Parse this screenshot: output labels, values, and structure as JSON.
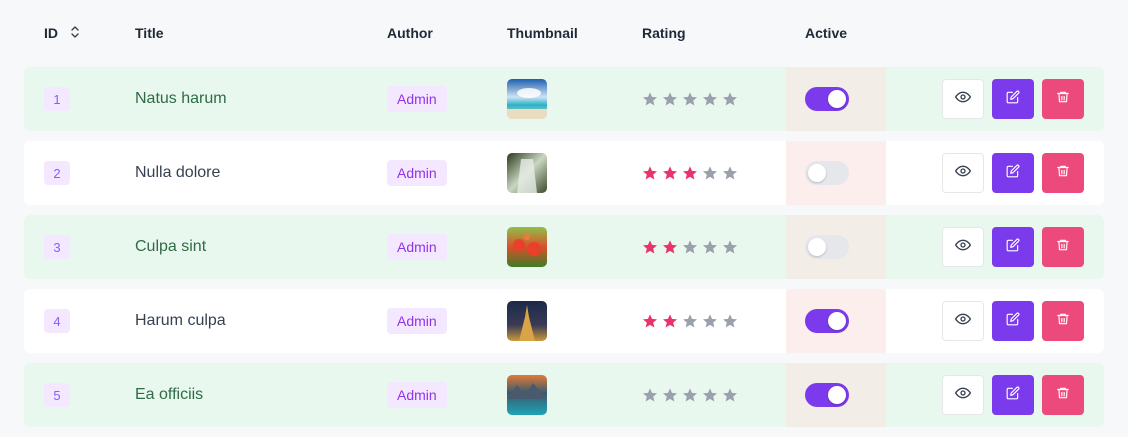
{
  "colors": {
    "accent": "#7c3aed",
    "danger": "#ec4a7c",
    "star_filled": "#e8336b",
    "star_empty": "#9aa0ac",
    "stripe": "#e9f8ee"
  },
  "columns": {
    "id": "ID",
    "title": "Title",
    "author": "Author",
    "thumbnail": "Thumbnail",
    "rating": "Rating",
    "active": "Active"
  },
  "rows": [
    {
      "id": "1",
      "title": "Natus harum",
      "author": "Admin",
      "thumbnail": "beach",
      "rating": 0,
      "active": true
    },
    {
      "id": "2",
      "title": "Nulla dolore",
      "author": "Admin",
      "thumbnail": "waterfall",
      "rating": 3,
      "active": false
    },
    {
      "id": "3",
      "title": "Culpa sint",
      "author": "Admin",
      "thumbnail": "poppies",
      "rating": 2,
      "active": false
    },
    {
      "id": "4",
      "title": "Harum culpa",
      "author": "Admin",
      "thumbnail": "eiffel-tower",
      "rating": 2,
      "active": true
    },
    {
      "id": "5",
      "title": "Ea officiis",
      "author": "Admin",
      "thumbnail": "mountain-lake",
      "rating": 0,
      "active": true
    }
  ],
  "icons": {
    "sort": "sort-updown-icon",
    "view": "eye-icon",
    "edit": "edit-icon",
    "delete": "trash-icon",
    "star": "star-icon"
  }
}
